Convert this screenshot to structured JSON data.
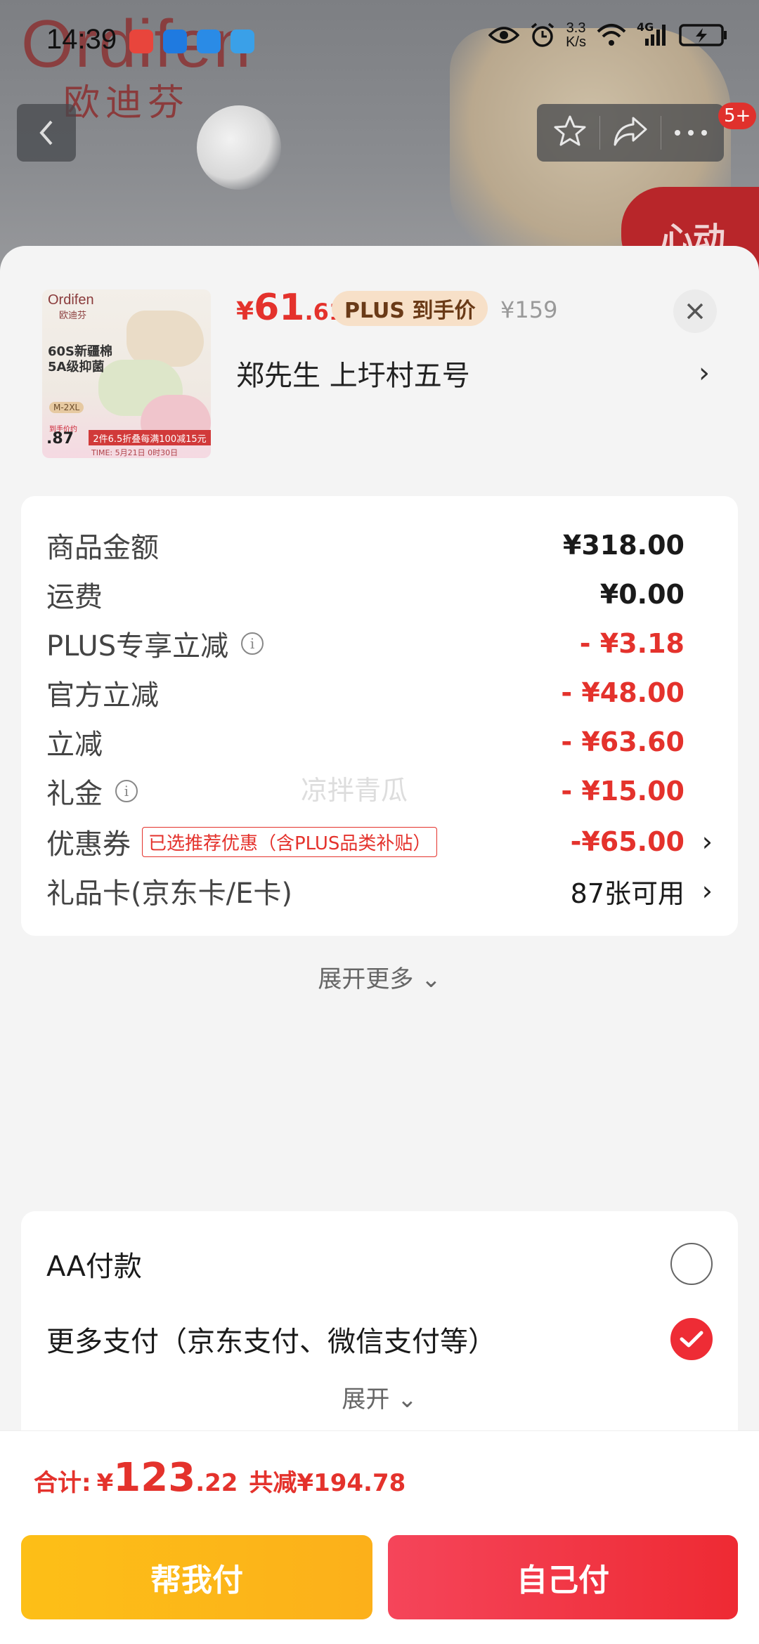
{
  "background": {
    "brand_en": "Ordifen",
    "brand_cn": "欧迪芬",
    "promo_badge": "心动"
  },
  "status_bar": {
    "time": "14:39",
    "net_speed_value": "3.3",
    "net_speed_unit": "K/s",
    "network": "4G"
  },
  "nav": {
    "badge_count": "5+"
  },
  "product": {
    "thumb": {
      "brand_en": "Ordifen",
      "brand_cn": "欧迪芬",
      "line1": "60S新疆棉",
      "line2": "5A级抑菌",
      "size": "M-2XL",
      "price_label": "到手价约",
      "price": ".87",
      "banner": "2件6.5折叠每满100减15元",
      "time": "TIME: 5月21日 0时30日"
    },
    "price_yen": "¥",
    "price_int": "61",
    "price_dec": ".61",
    "plus_tag": "PLUS 到手价",
    "original_price": "¥159",
    "address": "郑先生  上圩村五号"
  },
  "price_rows": [
    {
      "label": "商品金额",
      "value": "¥318.00"
    },
    {
      "label": "运费",
      "value": "¥0.00"
    },
    {
      "label": "PLUS专享立减",
      "value": "- ¥3.18"
    },
    {
      "label": "官方立减",
      "value": "- ¥48.00"
    },
    {
      "label": "立减",
      "value": "- ¥63.60"
    },
    {
      "label": "礼金",
      "value": "- ¥15.00"
    },
    {
      "label": "优惠券",
      "tag": "已选推荐优惠（含PLUS品类补贴）",
      "value": "-¥65.00"
    },
    {
      "label": "礼品卡(京东卡/E卡)",
      "value": "87张可用"
    }
  ],
  "expand_more": "展开更多",
  "watermark": "凉拌青瓜",
  "payment": {
    "options": [
      {
        "label": "AA付款",
        "selected": false
      },
      {
        "label": "更多支付（京东支付、微信支付等）",
        "selected": true
      }
    ],
    "expand": "展开"
  },
  "footer": {
    "total_label": "合计:",
    "total_yen": "¥",
    "total_int": "123",
    "total_dec": ".22",
    "saved": "共减¥194.78",
    "help_pay": "帮我付",
    "self_pay": "自己付"
  },
  "colors": {
    "accent_red": "#e4322c",
    "help_button": "#fdbf17",
    "self_button": "#ee2a33",
    "plus_tag_bg": "#f7e0c8"
  }
}
